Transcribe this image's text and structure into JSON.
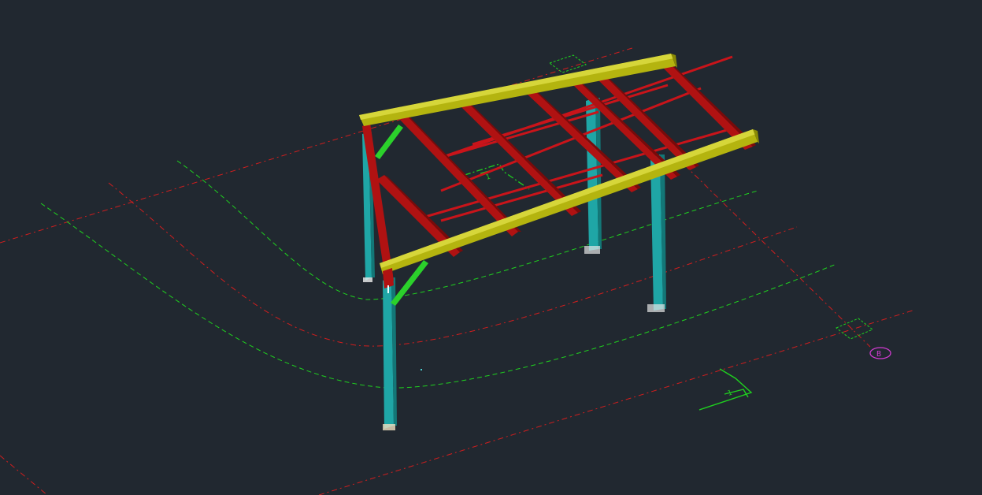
{
  "viewport": {
    "background": "#212830"
  },
  "colors": {
    "column": "#1fa6a6",
    "column_dark": "#137777",
    "rafter": "#b01212",
    "rafter_dark": "#7a0a0a",
    "purlin": "#c9141a",
    "eave_beam": "#b4b40f",
    "eave_beam_light": "#d6d63a",
    "brace": "#2bd12b",
    "grid_red": "#d11e1e",
    "grid_green": "#1fd11f",
    "grid_bubble": "#d13bd1"
  },
  "grid_marker": {
    "label": "B"
  },
  "icons": [
    "ucs-icon",
    "grid-bubble-icon",
    "section-marker-icon"
  ]
}
